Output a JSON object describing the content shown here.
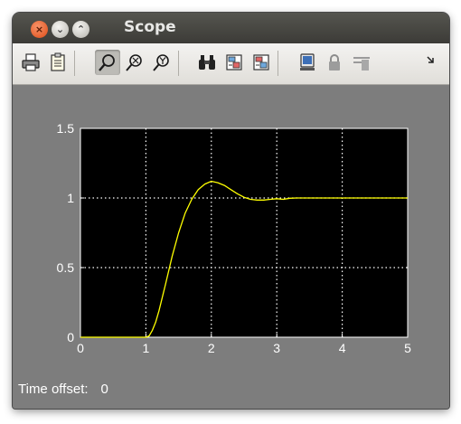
{
  "window": {
    "title": "Scope",
    "buttons": {
      "close": "×",
      "minimize": "⌄",
      "maximize": "⌃"
    }
  },
  "toolbar": {
    "items": [
      {
        "name": "print-icon"
      },
      {
        "name": "parameters-icon"
      },
      {
        "name": "zoom-icon",
        "active": true
      },
      {
        "name": "zoom-x-icon"
      },
      {
        "name": "zoom-y-icon"
      },
      {
        "name": "autoscale-icon"
      },
      {
        "name": "save-axes-settings-icon"
      },
      {
        "name": "restore-axes-settings-icon"
      },
      {
        "name": "floating-scope-icon"
      },
      {
        "name": "lock-axes-icon"
      },
      {
        "name": "signal-selection-icon"
      },
      {
        "name": "toolbar-overflow-icon"
      }
    ]
  },
  "footer": {
    "label": "Time offset:",
    "value": "0"
  },
  "chart_data": {
    "type": "line",
    "title": "",
    "xlabel": "",
    "ylabel": "",
    "xlim": [
      0,
      5
    ],
    "ylim": [
      0,
      1.5
    ],
    "xticks": [
      0,
      1,
      2,
      3,
      4,
      5
    ],
    "yticks": [
      0,
      0.5,
      1,
      1.5
    ],
    "xtick_labels": [
      "0",
      "1",
      "2",
      "3",
      "4",
      "5"
    ],
    "ytick_labels": [
      "0",
      "0.5",
      "1",
      "1.5"
    ],
    "grid": true,
    "line_color": "#ffff00",
    "series": [
      {
        "x": [
          0,
          1.0,
          1.05,
          1.1,
          1.15,
          1.2,
          1.3,
          1.4,
          1.5,
          1.6,
          1.7,
          1.8,
          1.9,
          2.0,
          2.1,
          2.2,
          2.3,
          2.4,
          2.5,
          2.6,
          2.7,
          2.8,
          2.9,
          3.0,
          3.1,
          3.2,
          3.3,
          3.4,
          3.5,
          4.0,
          4.5,
          5.0
        ],
        "y": [
          0,
          0,
          0.01,
          0.05,
          0.11,
          0.19,
          0.38,
          0.58,
          0.75,
          0.89,
          0.99,
          1.06,
          1.1,
          1.12,
          1.11,
          1.09,
          1.06,
          1.03,
          1.005,
          0.99,
          0.985,
          0.985,
          0.99,
          0.995,
          0.99,
          0.998,
          1.0,
          1.0,
          1.0,
          1.0,
          1.0,
          1.0
        ]
      }
    ]
  },
  "colors": {
    "figure_background": "#7d7d7d",
    "axes_background": "#000000",
    "grid": "#ffffff",
    "text": "#ffffff"
  }
}
